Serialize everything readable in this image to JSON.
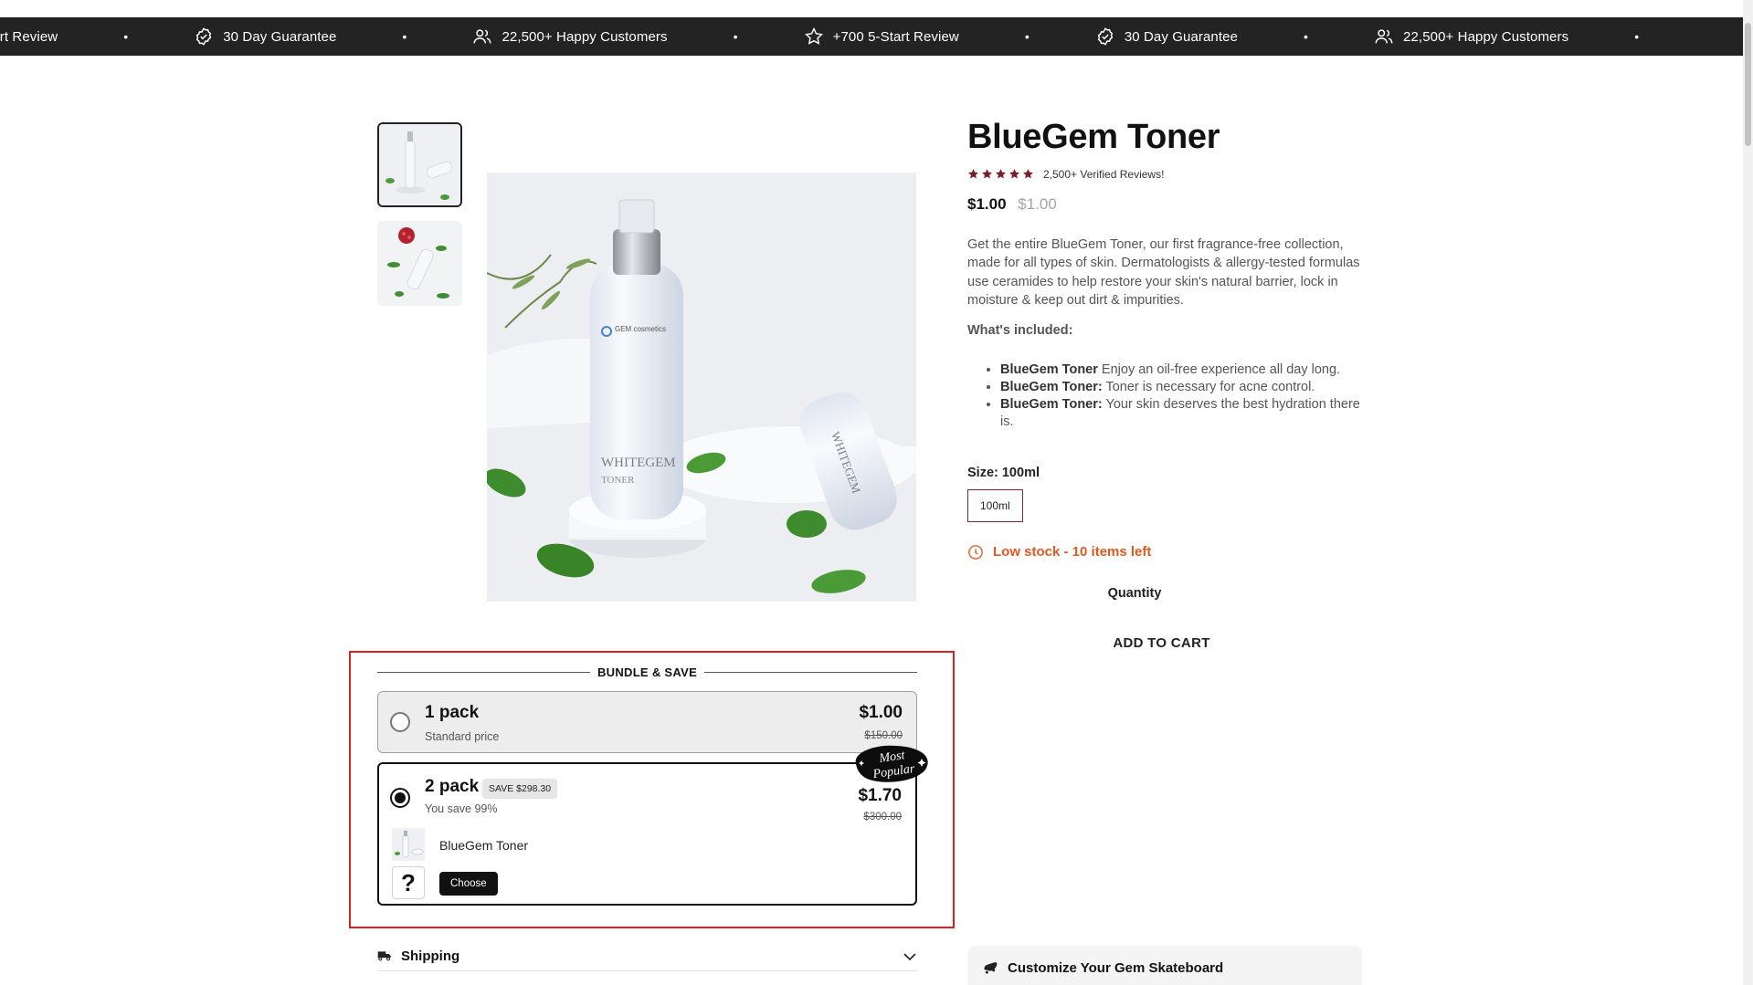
{
  "announcement_bar": {
    "items": [
      {
        "icon": "star-outline-icon",
        "text": "+700 5-Start Review"
      },
      {
        "icon": "check-circle-icon",
        "text": "30 Day Guarantee"
      },
      {
        "icon": "users-icon",
        "text": "22,500+ Happy Customers"
      },
      {
        "icon": "star-outline-icon",
        "text": "+700 5-Start Review"
      },
      {
        "icon": "check-circle-icon",
        "text": "30 Day Guarantee"
      },
      {
        "icon": "users-icon",
        "text": "22,500+ Happy Customers"
      }
    ],
    "separator": "•"
  },
  "product": {
    "title": "BlueGem Toner",
    "rating_text": "2,500+ Verified Reviews!",
    "rating_stars": 5,
    "price": "$1.00",
    "compare_price": "$1.00",
    "description": "Get the entire BlueGem Toner, our first fragrance-free collection, made for all types of skin. Dermatologists & allergy-tested formulas use ceramides to help restore your skin's natural barrier, lock in moisture & keep out dirt & impurities.",
    "included_label": "What's included:",
    "included": [
      {
        "name": "BlueGem Toner",
        "text": " Enjoy an oil-free experience all day long."
      },
      {
        "name": "BlueGem Toner:",
        "text": " Toner is necessary for acne control."
      },
      {
        "name": "BlueGem Toner:",
        "text": " Your skin deserves the best hydration there is."
      }
    ],
    "size_label": "Size: 100ml",
    "size_option": "100ml",
    "stock_text": "Low stock - 10 items left",
    "quantity_label": "Quantity",
    "add_to_cart": "ADD TO CART",
    "image_brand": "GEM cosmetics",
    "image_product": "WHITEGEM",
    "image_product_sub": "TONER"
  },
  "bundle": {
    "heading": "BUNDLE & SAVE",
    "packs": [
      {
        "name": "1 pack",
        "subtitle": "Standard price",
        "price": "$1.00",
        "compare": "$150.00",
        "selected": false
      },
      {
        "name": "2 pack",
        "badge": "SAVE $298.30",
        "subtitle": "You save 99%",
        "price": "$1.70",
        "compare": "$300.00",
        "selected": true,
        "item_name": "BlueGem Toner",
        "choose_label": "Choose",
        "placeholder_symbol": "?",
        "ribbon": "Most Popular"
      }
    ]
  },
  "accordions": {
    "shipping": "Shipping",
    "customize": "Customize Your Gem Skateboard"
  },
  "colors": {
    "star": "#7a1e29",
    "stock": "#e4571f",
    "size_border": "#8a2331",
    "highlight": "#e11f1f"
  }
}
